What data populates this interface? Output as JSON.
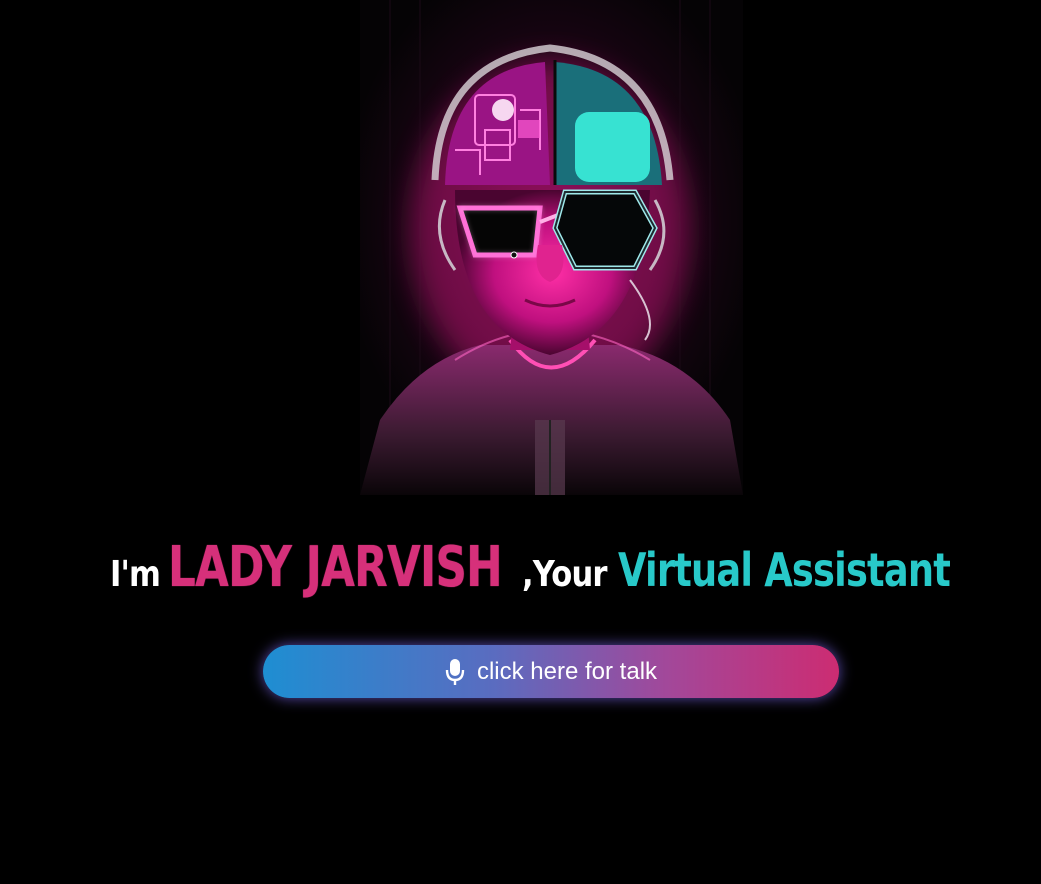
{
  "hero": {
    "image_icon": "cyberpunk-avatar",
    "accent_pink": "#e01a9a",
    "accent_cyan": "#2fd8cf"
  },
  "headline": {
    "prefix": "I'm",
    "name": "LADY JARVISH",
    "middle": ",Your",
    "role": "Virtual Assistant",
    "prefix_color": "#ffffff",
    "name_color": "#d6307a",
    "role_color": "#28c9c9"
  },
  "talk_button": {
    "icon": "microphone-icon",
    "label": "click here for talk",
    "gradient_start": "#1e8ed2",
    "gradient_end": "#cc2c72"
  }
}
